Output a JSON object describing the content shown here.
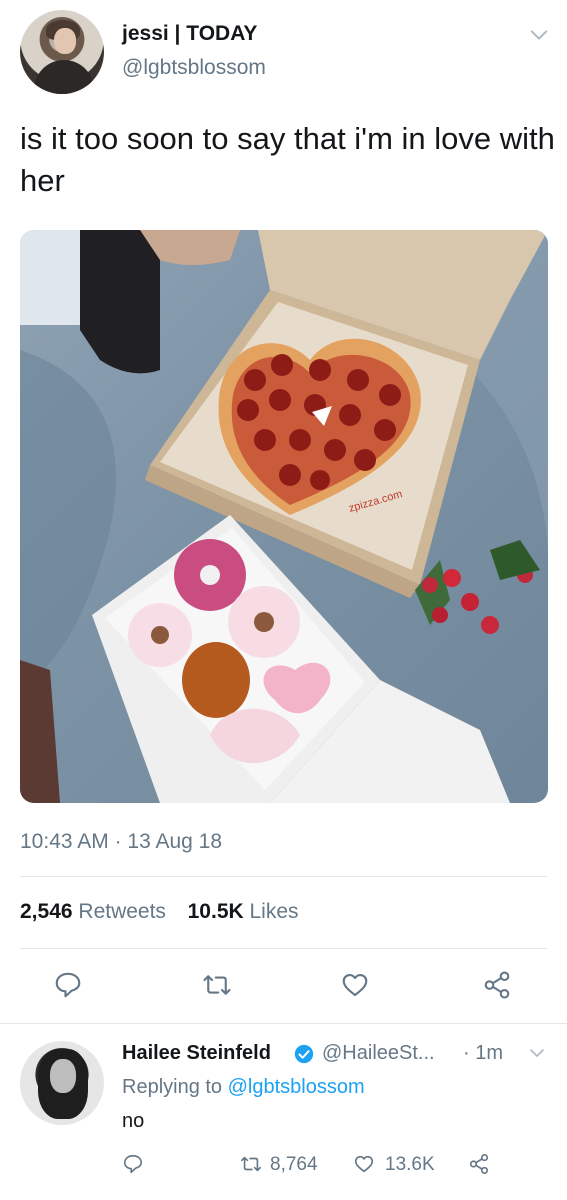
{
  "tweet": {
    "display_name": "jessi | TODAY",
    "handle": "@lgbtsblossom",
    "text": "is it too soon to say that i'm in love with her",
    "time": "10:43 AM",
    "date_sep": " · ",
    "date": "13 Aug 18",
    "retweets_count": "2,546",
    "retweets_label": " Retweets",
    "likes_count": "10.5K",
    "likes_label": " Likes",
    "photo": {
      "box_text": "zpizza.com"
    }
  },
  "reply": {
    "display_name": "Hailee Steinfeld",
    "handle": "@HaileeSt...",
    "time": "· 1m",
    "replying_prefix": "Replying to ",
    "replying_handle": "@lgbtsblossom",
    "text": "no",
    "retweets": "8,764",
    "likes": "13.6K"
  },
  "icons": {
    "caret": "chevron-down-icon",
    "reply": "reply-icon",
    "retweet": "retweet-icon",
    "like": "heart-icon",
    "share": "share-icon",
    "verified": "verified-badge-icon"
  },
  "colors": {
    "accent": "#1da1f2",
    "secondary_text": "#657786",
    "primary_text": "#14171a",
    "divider": "#e1e8ed"
  }
}
